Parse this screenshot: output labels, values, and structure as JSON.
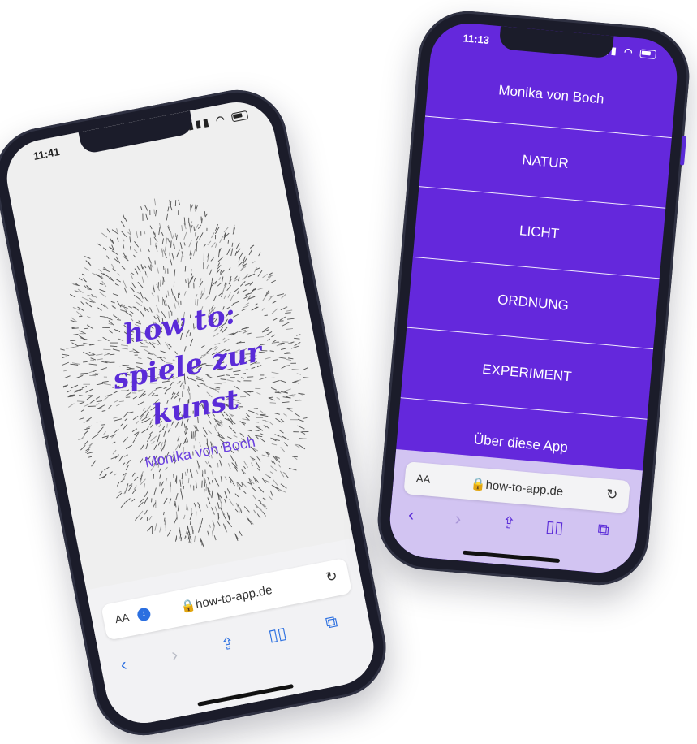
{
  "phone_left": {
    "status_time": "11:41",
    "title_lines": [
      "how to:",
      "spiele zur",
      "kunst"
    ],
    "author": "Monika von Boch",
    "browser": {
      "text_size": "AA",
      "url": "how-to-app.de",
      "back_icon": "chevron-left-icon",
      "forward_icon": "chevron-right-icon",
      "share_icon": "share-icon",
      "bookmarks_icon": "book-icon",
      "tabs_icon": "tabs-icon"
    }
  },
  "phone_right": {
    "status_time": "11:13",
    "menu": [
      {
        "label": "Monika von Boch"
      },
      {
        "label": "NATUR"
      },
      {
        "label": "LICHT"
      },
      {
        "label": "ORDNUNG"
      },
      {
        "label": "EXPERIMENT"
      },
      {
        "label": "Über diese App"
      }
    ],
    "browser": {
      "text_size": "AA",
      "url": "how-to-app.de"
    }
  },
  "colors": {
    "accent_purple": "#6428dc",
    "toolbar_lilac": "#d2c4f2",
    "safari_blue": "#2b6fe0"
  }
}
